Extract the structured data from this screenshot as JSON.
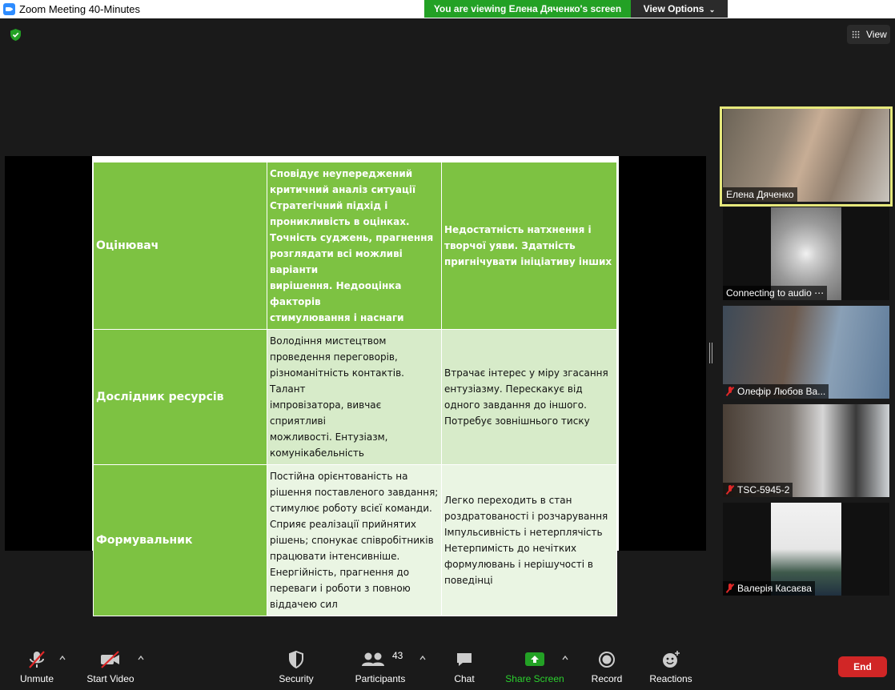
{
  "window": {
    "title": "Zoom Meeting 40-Minutes"
  },
  "banner": {
    "text": "You are viewing Елена Дяченко's screen",
    "view_options": "View Options"
  },
  "view_button": {
    "label": "View"
  },
  "slide": {
    "rows": [
      {
        "role": "Оцінювач",
        "c2": [
          "Сповідує неупереджений",
          "критичний аналіз ситуації",
          "Стратегічний підхід і",
          "проникливість в оцінках.",
          "Точність суджень, прагнення",
          "розглядати всі можливі варіанти",
          "вирішення. Недооцінка факторів",
          "стимулювання і наснаги"
        ],
        "c3": [
          "Недостатність натхнення і",
          "творчої уяви. Здатність",
          "пригнічувати ініціативу інших"
        ]
      },
      {
        "role": "Дослідник ресурсів",
        "c2": [
          "Володіння мистецтвом",
          "проведення переговорів,",
          "різноманітність контактів. Талант",
          "імпровізатора, вивчає сприятливі",
          "можливості. Ентузіазм,",
          "комунікабельність"
        ],
        "c3": [
          "Втрачає інтерес у міру згасання",
          "ентузіазму. Перескакує від",
          "одного завдання до іншого.",
          "Потребує зовнішнього тиску"
        ]
      },
      {
        "role": "Формувальник",
        "c2": [
          "Постійна орієнтованість на",
          "рішення поставленого завдання;",
          "стимулює роботу всієї команди.",
          "Сприяє реалізації прийнятих",
          "рішень; спонукає співробітників",
          "працювати інтенсивніше.",
          "Енергійність, прагнення до",
          "переваги і роботи з повною",
          "віддачею сил"
        ],
        "c3": [
          "Легко переходить в стан",
          "роздратованості і розчарування",
          "Імпульсивність і нетерплячість",
          "Нетерпимість до нечітких",
          "формулювань і нерішучості в",
          "поведінці"
        ]
      }
    ]
  },
  "participants_panel": [
    {
      "name": "Елена Дяченко",
      "muted": false,
      "active": true
    },
    {
      "name": "Connecting to audio ⋯",
      "muted": false,
      "active": false
    },
    {
      "name": "Олефір Любов Ва...",
      "muted": true,
      "active": false
    },
    {
      "name": "TSC-5945-2",
      "muted": true,
      "active": false
    },
    {
      "name": "Валерія Касаєва",
      "muted": true,
      "active": false
    }
  ],
  "toolbar": {
    "unmute": "Unmute",
    "start_video": "Start Video",
    "security": "Security",
    "participants": "Participants",
    "participants_count": "43",
    "chat": "Chat",
    "share_screen": "Share Screen",
    "record": "Record",
    "reactions": "Reactions",
    "end": "End"
  },
  "colors": {
    "share_green": "#23a125",
    "slide_green": "#7dc242",
    "end_red": "#d12626",
    "active_border": "#e6e87c"
  }
}
